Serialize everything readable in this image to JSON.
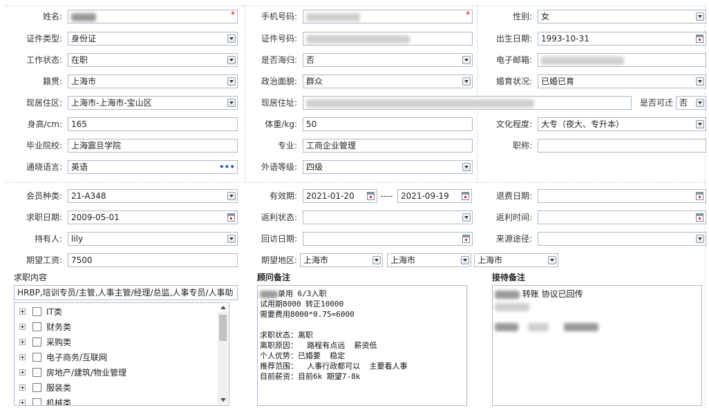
{
  "personal": {
    "name_label": "姓名:",
    "phone_label": "手机号码:",
    "gender_label": "性别:",
    "gender_value": "女",
    "id_type_label": "证件类型:",
    "id_type_value": "身份证",
    "id_no_label": "证件号码:",
    "birth_label": "出生日期:",
    "birth_value": "1993-10-31",
    "work_status_label": "工作状态:",
    "work_status_value": "在职",
    "overseas_label": "是否海归:",
    "overseas_value": "否",
    "email_label": "电子邮箱:",
    "native_label": "籍贯:",
    "native_value": "上海市",
    "political_label": "政治面貌:",
    "political_value": "群众",
    "marital_label": "婚育状况:",
    "marital_value": "已婚已育",
    "residence_area_label": "现居住区:",
    "residence_area_value": "上海市-上海市-宝山区",
    "address_label": "现居住址:",
    "relocate_label": "是否可迁",
    "relocate_value": "否",
    "height_label": "身高/cm:",
    "height_value": "165",
    "weight_label": "体重/kg:",
    "weight_value": "50",
    "education_label": "文化程度:",
    "education_value": "大专（夜大、专升本）",
    "school_label": "毕业院校:",
    "school_value": "上海震旦学院",
    "major_label": "专业:",
    "major_value": "工商企业管理",
    "title_label": "职称:",
    "language_label": "通晓语言:",
    "language_value": "英语",
    "language_more": "•••",
    "lang_level_label": "外语等级:",
    "lang_level_value": "四级",
    "required_mark": "*"
  },
  "membership": {
    "member_type_label": "会员种类:",
    "member_type_value": "21-A348",
    "valid_label": "有效期:",
    "valid_from": "2021-01-20",
    "valid_sep": "----",
    "valid_to": "2021-09-19",
    "refund_date_label": "退费日期:",
    "job_date_label": "求职日期:",
    "job_date_value": "2009-05-01",
    "rebate_status_label": "返利状态:",
    "rebate_time_label": "返利时间:",
    "holder_label": "持有人:",
    "holder_value": "lily",
    "visit_date_label": "回访日期:",
    "source_label": "来源途径:",
    "salary_label": "期望工资:",
    "salary_value": "7500",
    "region_label": "期望地区:",
    "region_values": [
      "上海市",
      "上海市",
      "上海市"
    ]
  },
  "job_panel": {
    "title": "求职内容",
    "summary": "HRBP,培训专员/主管,人事主管/经理/总监,人事专员/人事助",
    "categories": [
      "IT类",
      "财务类",
      "采购类",
      "电子商务/互联网",
      "房地产/建筑/物业管理",
      "服装类",
      "机械类"
    ]
  },
  "advisor_panel": {
    "title": "顾问备注",
    "lines": [
      "录用 6/3入职",
      "试用期8000 转正10000",
      "需要费用8000*0.75=6000",
      "",
      "求职状态：离职",
      "离职原因：  路程有点远  薪资低",
      "个人优势：已婚要  稳定",
      "推荐范围：  人事行政都可以  主要看人事",
      "目前薪资：目前6k 期望7-8k"
    ]
  },
  "reception_panel": {
    "title": "接待备注",
    "line1": "转账 协议已回传"
  }
}
